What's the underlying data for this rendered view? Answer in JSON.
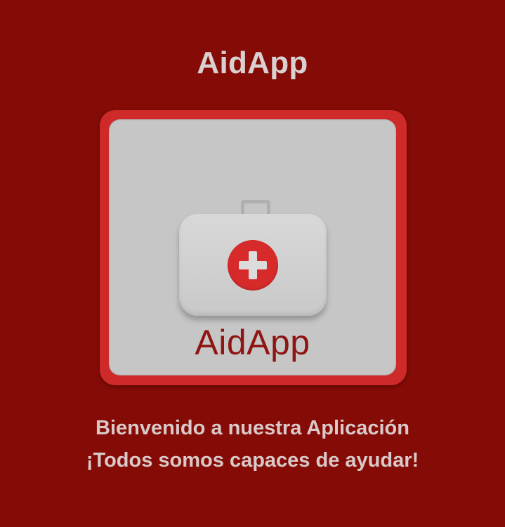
{
  "app": {
    "title": "AidApp"
  },
  "logo": {
    "wordmark": "AidApp",
    "icon": "first-aid-kit-icon",
    "colors": {
      "frame": "#cf2a2a",
      "card": "#c6c6c6",
      "cross": "#d72a2a",
      "wordmark": "#8e1512"
    }
  },
  "welcome": {
    "line1": "Bienvenido a nuestra Aplicación",
    "line2": "¡Todos somos capaces de ayudar!"
  },
  "theme": {
    "background": "#850c06",
    "text": "#d9d1d1"
  }
}
